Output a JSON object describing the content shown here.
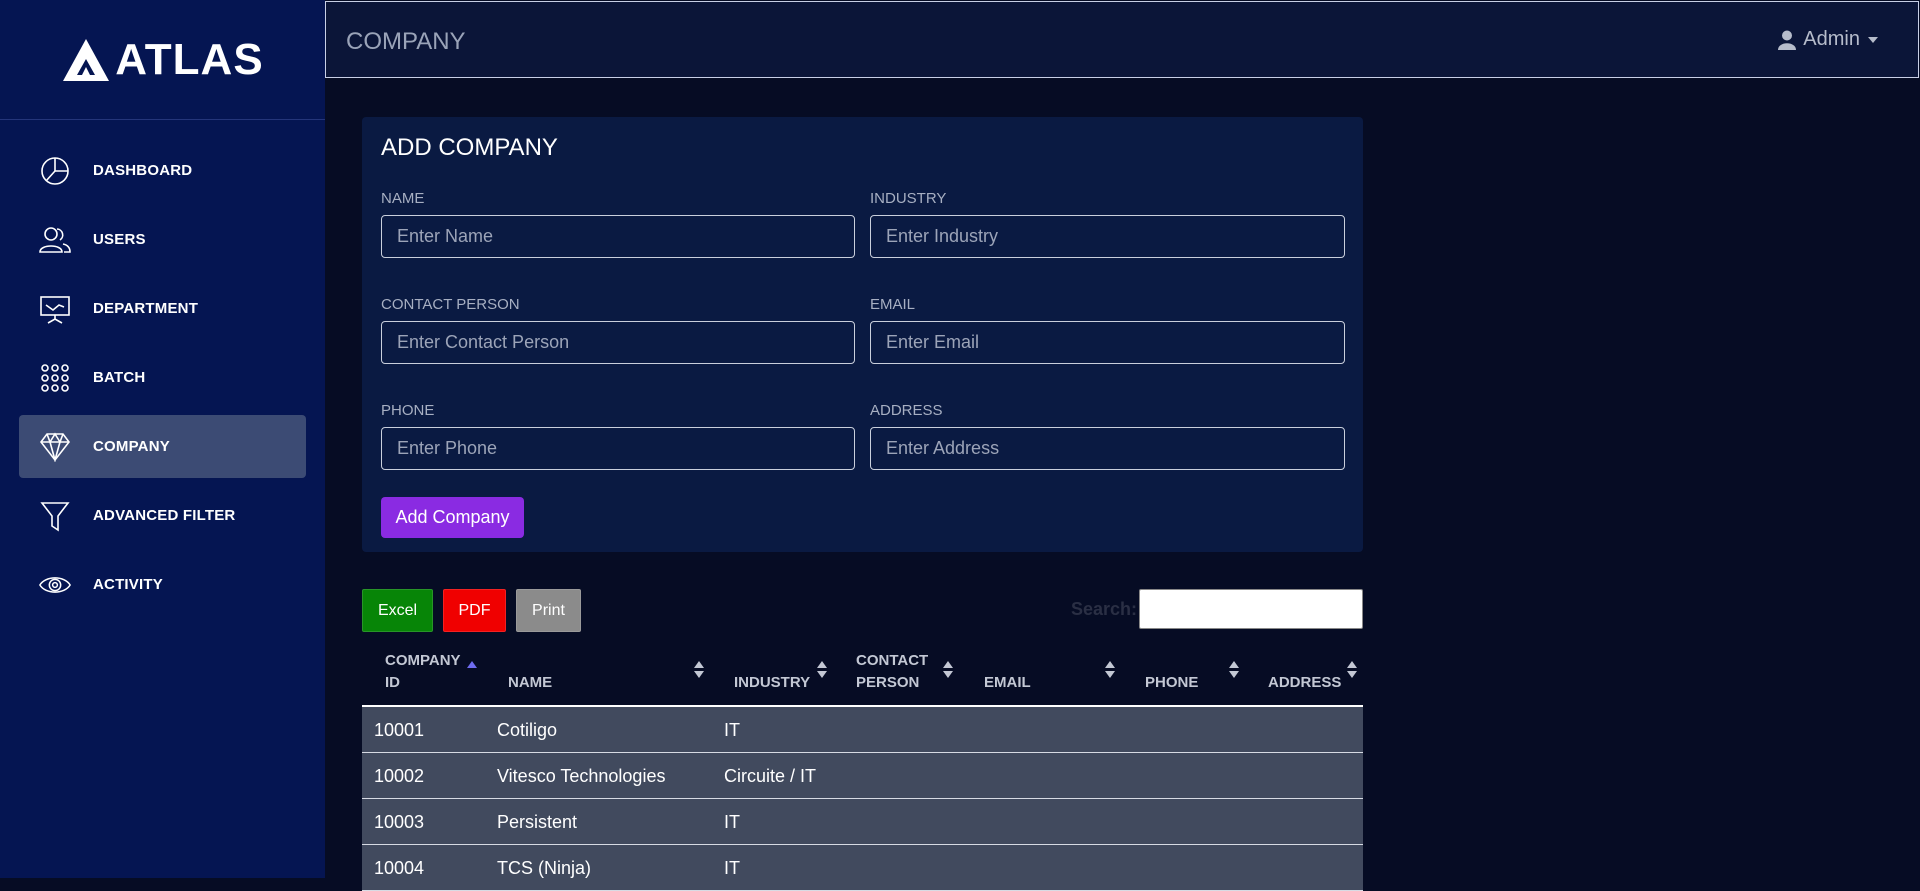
{
  "brand": {
    "name": "ATLAS"
  },
  "sidebar": {
    "items": [
      {
        "label": "DASHBOARD",
        "icon": "pie-chart-icon"
      },
      {
        "label": "USERS",
        "icon": "users-icon"
      },
      {
        "label": "DEPARTMENT",
        "icon": "presentation-icon"
      },
      {
        "label": "BATCH",
        "icon": "grid-dots-icon"
      },
      {
        "label": "COMPANY",
        "icon": "diamond-icon",
        "active": true
      },
      {
        "label": "ADVANCED FILTER",
        "icon": "filter-icon"
      },
      {
        "label": "ACTIVITY",
        "icon": "eye-icon"
      }
    ]
  },
  "header": {
    "title": "COMPANY",
    "user": "Admin"
  },
  "form": {
    "title": "ADD COMPANY",
    "fields": {
      "name": {
        "label": "NAME",
        "placeholder": "Enter Name"
      },
      "industry": {
        "label": "INDUSTRY",
        "placeholder": "Enter Industry"
      },
      "contact": {
        "label": "CONTACT PERSON",
        "placeholder": "Enter Contact Person"
      },
      "email": {
        "label": "EMAIL",
        "placeholder": "Enter Email"
      },
      "phone": {
        "label": "PHONE",
        "placeholder": "Enter Phone"
      },
      "address": {
        "label": "ADDRESS",
        "placeholder": "Enter Address"
      }
    },
    "submit_label": "Add Company"
  },
  "toolbar": {
    "excel": "Excel",
    "pdf": "PDF",
    "print": "Print",
    "search_label": "Search:"
  },
  "table": {
    "columns": {
      "id": {
        "line1": "COMPANY",
        "line2": "ID"
      },
      "name": "NAME",
      "industry": "INDUSTRY",
      "contact": {
        "line1": "CONTACT",
        "line2": "PERSON"
      },
      "email": "EMAIL",
      "phone": "PHONE",
      "address": "ADDRESS"
    },
    "rows": [
      {
        "id": "10001",
        "name": "Cotiligo",
        "industry": "IT"
      },
      {
        "id": "10002",
        "name": "Vitesco Technologies",
        "industry": "Circuite / IT"
      },
      {
        "id": "10003",
        "name": "Persistent",
        "industry": "IT"
      },
      {
        "id": "10004",
        "name": "TCS (Ninja)",
        "industry": "IT"
      }
    ]
  },
  "colors": {
    "sidebar": "#051552",
    "active": "#3c4b74",
    "accent": "#8a2be2",
    "excel": "#078507",
    "pdf": "#f00000",
    "print": "#8b8b8b"
  }
}
